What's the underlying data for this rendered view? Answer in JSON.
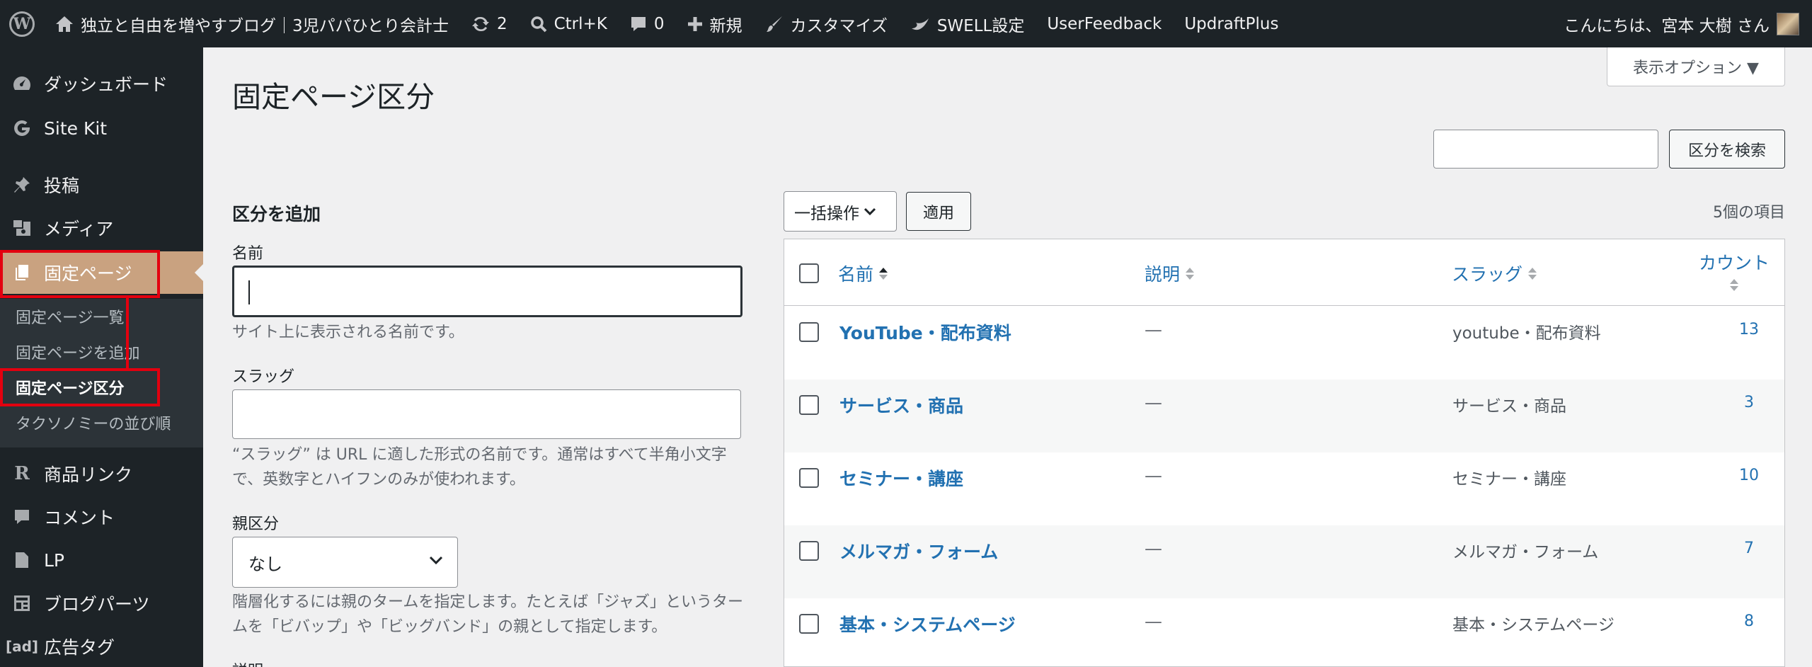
{
  "admin_bar": {
    "site_name": "独立と自由を増やすブログ｜3児パパひとり会計士",
    "updates_count": "2",
    "shortcut": "Ctrl+K",
    "comments_count": "0",
    "new_label": "新規",
    "customize_label": "カスタマイズ",
    "swell_label": "SWELL設定",
    "userfeedback_label": "UserFeedback",
    "updraftplus_label": "UpdraftPlus",
    "greeting": "こんにちは、宮本 大樹 さん"
  },
  "sidebar": {
    "items": [
      {
        "label": "ダッシュボード",
        "icon": "dashboard-icon"
      },
      {
        "label": "Site Kit",
        "icon": "google-g-icon"
      },
      {
        "label": "投稿",
        "icon": "pushpin-icon"
      },
      {
        "label": "メディア",
        "icon": "media-icon"
      },
      {
        "label": "固定ページ",
        "icon": "pages-icon",
        "current": true
      },
      {
        "label": "商品リンク",
        "icon": "r-icon"
      },
      {
        "label": "コメント",
        "icon": "comment-icon"
      },
      {
        "label": "LP",
        "icon": "document-icon"
      },
      {
        "label": "ブログパーツ",
        "icon": "blocks-icon"
      },
      {
        "label": "広告タグ",
        "icon": "ad-icon"
      }
    ],
    "submenu": [
      {
        "label": "固定ページ一覧"
      },
      {
        "label": "固定ページを追加"
      },
      {
        "label": "固定ページ区分",
        "current": true
      },
      {
        "label": "タクソノミーの並び順"
      }
    ]
  },
  "page": {
    "title": "固定ページ区分",
    "screen_options": "表示オプション ▼",
    "search_button": "区分を検索"
  },
  "add_form": {
    "heading": "区分を追加",
    "name_label": "名前",
    "name_value": "",
    "name_desc": "サイト上に表示される名前です。",
    "slug_label": "スラッグ",
    "slug_value": "",
    "slug_desc": "“スラッグ” は URL に適した形式の名前です。通常はすべて半角小文字で、英数字とハイフンのみが使われます。",
    "parent_label": "親区分",
    "parent_value": "なし",
    "parent_desc": "階層化するには親のタームを指定します。たとえば「ジャズ」というタームを「ビバップ」や「ビッグバンド」の親として指定します。",
    "description_label": "説明"
  },
  "list": {
    "bulk_action": "一括操作",
    "apply_button": "適用",
    "item_count": "5個の項目",
    "columns": {
      "name": "名前",
      "description": "説明",
      "slug": "スラッグ",
      "count": "カウント"
    },
    "rows": [
      {
        "name": "YouTube・配布資料",
        "description": "—",
        "slug": "youtube・配布資料",
        "count": "13"
      },
      {
        "name": "サービス・商品",
        "description": "—",
        "slug": "サービス・商品",
        "count": "3"
      },
      {
        "name": "セミナー・講座",
        "description": "—",
        "slug": "セミナー・講座",
        "count": "10"
      },
      {
        "name": "メルマガ・フォーム",
        "description": "—",
        "slug": "メルマガ・フォーム",
        "count": "7"
      },
      {
        "name": "基本・システムページ",
        "description": "—",
        "slug": "基本・システムページ",
        "count": "8"
      }
    ]
  },
  "colors": {
    "admin_bar": "#1d2327",
    "sidebar": "#1d2327",
    "accent": "#2271b1",
    "highlight_box": "#e3000f"
  }
}
